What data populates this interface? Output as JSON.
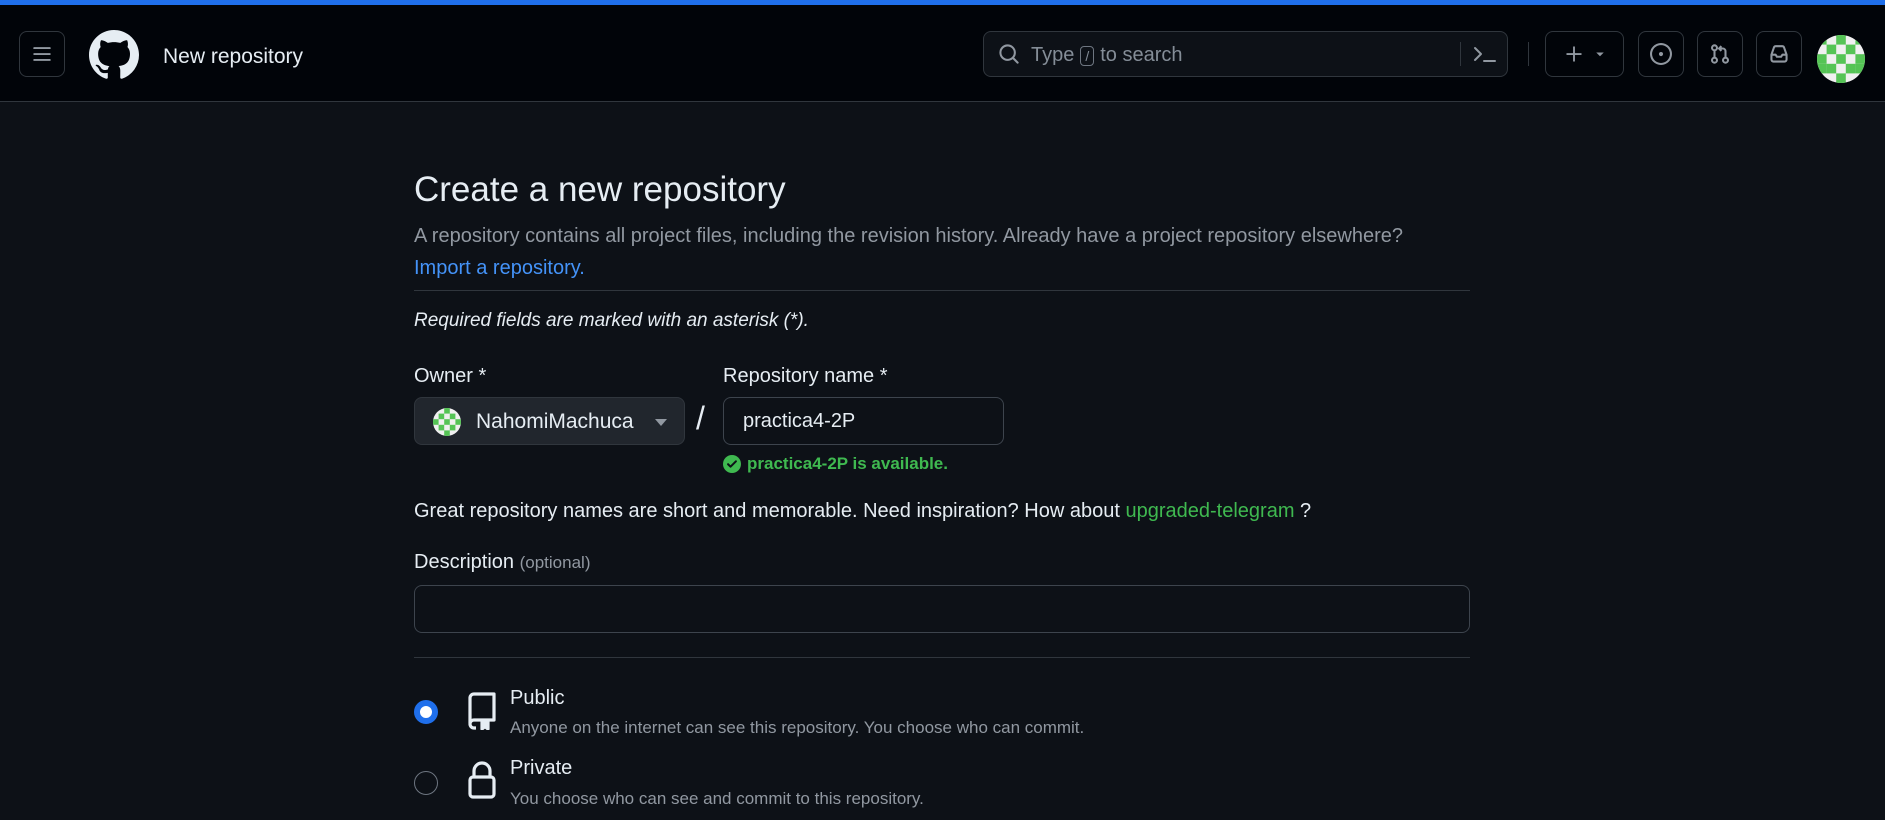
{
  "header": {
    "context_title": "New repository",
    "search": {
      "prefix": "Type",
      "key": "/",
      "suffix": "to search"
    }
  },
  "page": {
    "title": "Create a new repository",
    "subtitle": "A repository contains all project files, including the revision history. Already have a project repository elsewhere?",
    "import_link": "Import a repository.",
    "required_note": "Required fields are marked with an asterisk (*).",
    "owner_label": "Owner *",
    "owner_value": "NahomiMachuca",
    "separator": "/",
    "repo_name_label": "Repository name *",
    "repo_name_value": "practica4-2P",
    "availability": "practica4-2P is available.",
    "inspiration_text": "Great repository names are short and memorable. Need inspiration? How about",
    "suggestion": "upgraded-telegram",
    "inspiration_end": "?",
    "description_label": "Description",
    "description_optional": "(optional)",
    "description_value": "",
    "visibility": [
      {
        "title": "Public",
        "desc": "Anyone on the internet can see this repository. You choose who can commit.",
        "selected": true
      },
      {
        "title": "Private",
        "desc": "You choose who can see and commit to this repository.",
        "selected": false
      }
    ]
  },
  "colors": {
    "accent": "#1f6feb",
    "link": "#4493f8",
    "success": "#3fb950",
    "background": "#0d1117",
    "header_bg": "#010409"
  },
  "icons": [
    "hamburger-icon",
    "github-logo-icon",
    "search-icon",
    "terminal-icon",
    "plus-icon",
    "chevron-down-icon",
    "issue-icon",
    "pull-request-icon",
    "inbox-icon",
    "check-circle-icon",
    "repo-icon",
    "lock-icon"
  ]
}
